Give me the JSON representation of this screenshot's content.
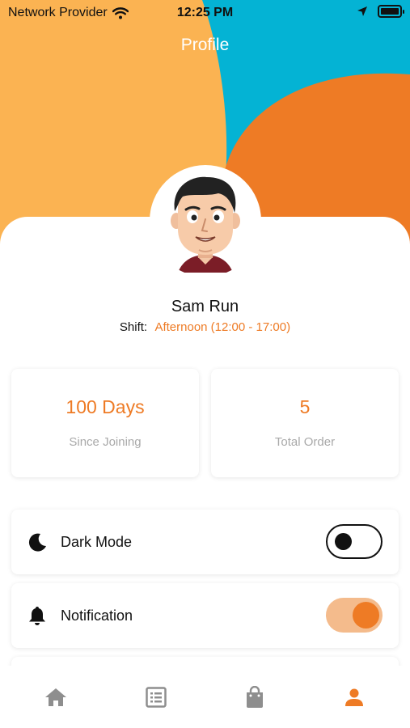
{
  "status_bar": {
    "carrier": "Network Provider",
    "time": "12:25 PM",
    "wifi_icon": "wifi-icon",
    "location_icon": "location-arrow-icon",
    "battery_icon": "battery-icon"
  },
  "header": {
    "title": "Profile"
  },
  "colors": {
    "accent": "#ee7b25",
    "header_yellow": "#fbb352",
    "header_cyan": "#04b3d4",
    "header_orange": "#ee7b25",
    "toggle_on_track": "#f4bb8c"
  },
  "profile": {
    "name": "Sam Run",
    "shift_label": "Shift:",
    "shift_value": "Afternoon (12:00 - 17:00)"
  },
  "stats": [
    {
      "value": "100 Days",
      "caption": "Since Joining"
    },
    {
      "value": "5",
      "caption": "Total Order"
    }
  ],
  "settings": [
    {
      "label": "Dark Mode",
      "icon": "moon-icon",
      "enabled": false
    },
    {
      "label": "Notification",
      "icon": "bell-icon",
      "enabled": true
    }
  ],
  "bottom_nav": [
    {
      "icon": "home-icon",
      "active": false
    },
    {
      "icon": "list-icon",
      "active": false
    },
    {
      "icon": "shopping-bag-icon",
      "active": false
    },
    {
      "icon": "person-icon",
      "active": true
    }
  ]
}
